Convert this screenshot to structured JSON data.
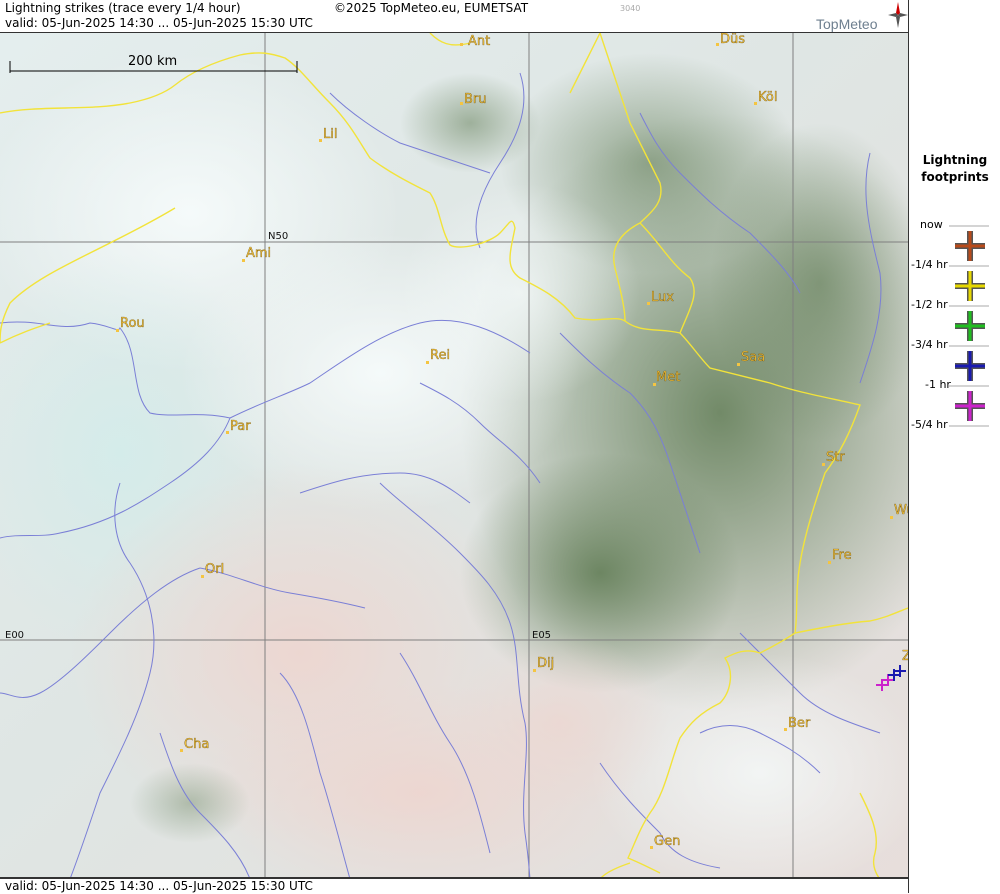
{
  "header": {
    "title": "Lightning strikes (trace every 1/4 hour)",
    "copyright": "©2025 TopMeteo.eu, EUMETSAT",
    "code": "3040",
    "valid": "valid:  05-Jun-2025 14:30 ... 05-Jun-2025 15:30 UTC",
    "logo": "TopMeteo"
  },
  "footer": {
    "valid": "valid:  05-Jun-2025 14:30 ... 05-Jun-2025 15:30 UTC"
  },
  "scale": {
    "label": "200 km"
  },
  "grid_labels": {
    "lat50": "N50",
    "lon0": "E00",
    "lon5": "E05"
  },
  "cities": [
    "Ant",
    "Düs",
    "Bru",
    "Köl",
    "Lil",
    "Ami",
    "Rou",
    "Lux",
    "Rei",
    "Saa",
    "Met",
    "Par",
    "Str",
    "Wü",
    "Fre",
    "Orl",
    "Dij",
    "Ber",
    "Cha",
    "Gen",
    "Z"
  ],
  "legend": {
    "title_line1": "Lightning",
    "title_line2": "footprints",
    "now": "now",
    "items": [
      {
        "label": "-1/4 hr",
        "color": "#b84a1a"
      },
      {
        "label": "-1/2 hr",
        "color": "#e6d800"
      },
      {
        "label": "-3/4 hr",
        "color": "#1fbf1f"
      },
      {
        "label": "-1 hr",
        "color": "#1a1ab0"
      },
      {
        "label": "-5/4 hr",
        "color": "#cc22cc"
      }
    ]
  },
  "colors": {
    "border": "#f2e33a",
    "river": "#7a7fd6",
    "city": "#f4c542",
    "grid": "#7f7f7f"
  }
}
